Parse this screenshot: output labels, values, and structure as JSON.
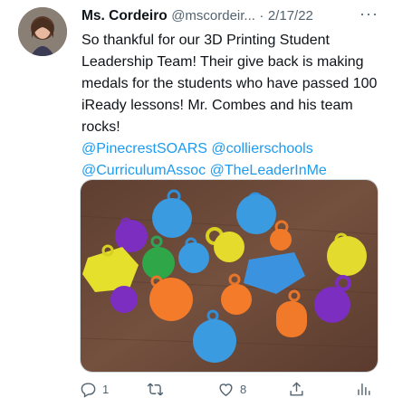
{
  "author": {
    "display_name": "Ms. Cordeiro",
    "handle": "@mscordeir...",
    "separator": "·",
    "date": "2/17/22"
  },
  "more_label": "···",
  "tweet": {
    "text": "So thankful for our 3D Printing Student Leadership Team! Their give back is making medals for the students who have passed 100 iReady lessons! Mr. Combes and his team rocks!",
    "mentions": [
      "@PinecrestSOARS",
      "@collierschools",
      "@CurriculumAssoc",
      "@TheLeaderInMe"
    ]
  },
  "actions": {
    "reply_count": "1",
    "retweet_count": "",
    "like_count": "8"
  },
  "icons": {
    "reply": "reply-icon",
    "retweet": "retweet-icon",
    "like": "heart-icon",
    "share": "share-icon",
    "analytics": "analytics-icon"
  },
  "colors": {
    "link": "#1d9bf0",
    "secondary_text": "#536471",
    "table_wood": "#6b4a3a"
  }
}
